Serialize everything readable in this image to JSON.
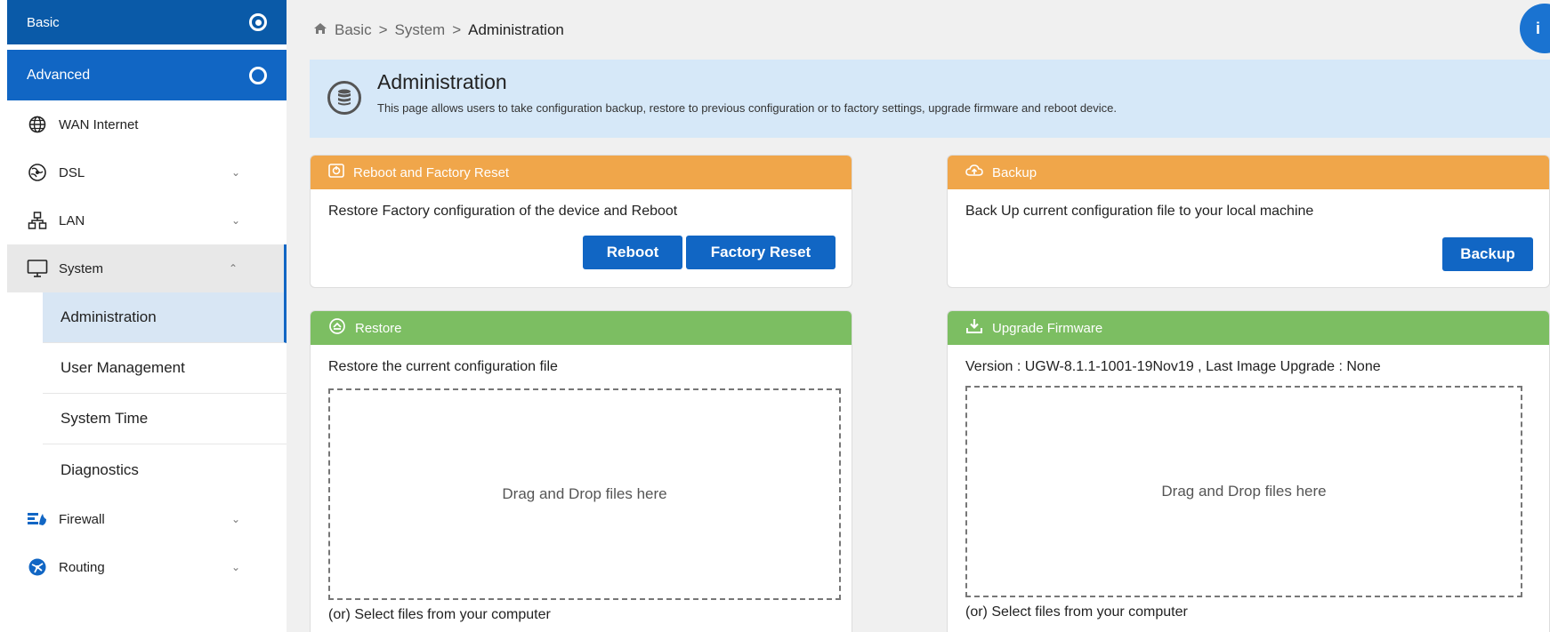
{
  "sidebar": {
    "mode_basic": "Basic",
    "mode_advanced": "Advanced",
    "items": [
      {
        "label": "WAN Internet",
        "icon": "globe-icon"
      },
      {
        "label": "DSL",
        "icon": "globe-network-icon"
      },
      {
        "label": "LAN",
        "icon": "network-icon"
      },
      {
        "label": "System",
        "icon": "monitor-icon"
      },
      {
        "label": "Firewall",
        "icon": "firewall-icon"
      },
      {
        "label": "Routing",
        "icon": "routing-icon"
      }
    ],
    "system_subitems": [
      "Administration",
      "User Management",
      "System Time",
      "Diagnostics"
    ]
  },
  "breadcrumb": {
    "items": [
      "Basic",
      "System",
      "Administration"
    ],
    "separator": ">"
  },
  "fab": {
    "label": "i"
  },
  "banner": {
    "title": "Administration",
    "description": "This page allows users to take configuration backup, restore to previous configuration or to factory settings, upgrade firmware and reboot device."
  },
  "reboot_card": {
    "title": "Reboot and Factory Reset",
    "text": "Restore Factory configuration of the device and Reboot",
    "reboot_label": "Reboot",
    "factory_reset_label": "Factory Reset"
  },
  "backup_card": {
    "title": "Backup",
    "text": "Back Up current configuration file to your local machine",
    "backup_label": "Backup"
  },
  "restore_card": {
    "title": "Restore",
    "text": "Restore the current configuration file",
    "drop_text": "Drag and Drop files here",
    "select_text": "(or) Select files from your computer"
  },
  "firmware_card": {
    "title": "Upgrade Firmware",
    "version_prefix": "Version : UGW-8.1.1-1001-19Nov19 , Last Image Upgrade : ",
    "last_upgrade": "None",
    "drop_text": "Drag and Drop files here",
    "select_text": "(or) Select files from your computer"
  },
  "colors": {
    "primary": "#1166c4",
    "orange_header": "#f0a64a",
    "green_header": "#7cbe62",
    "banner_bg": "#d6e8f8"
  }
}
